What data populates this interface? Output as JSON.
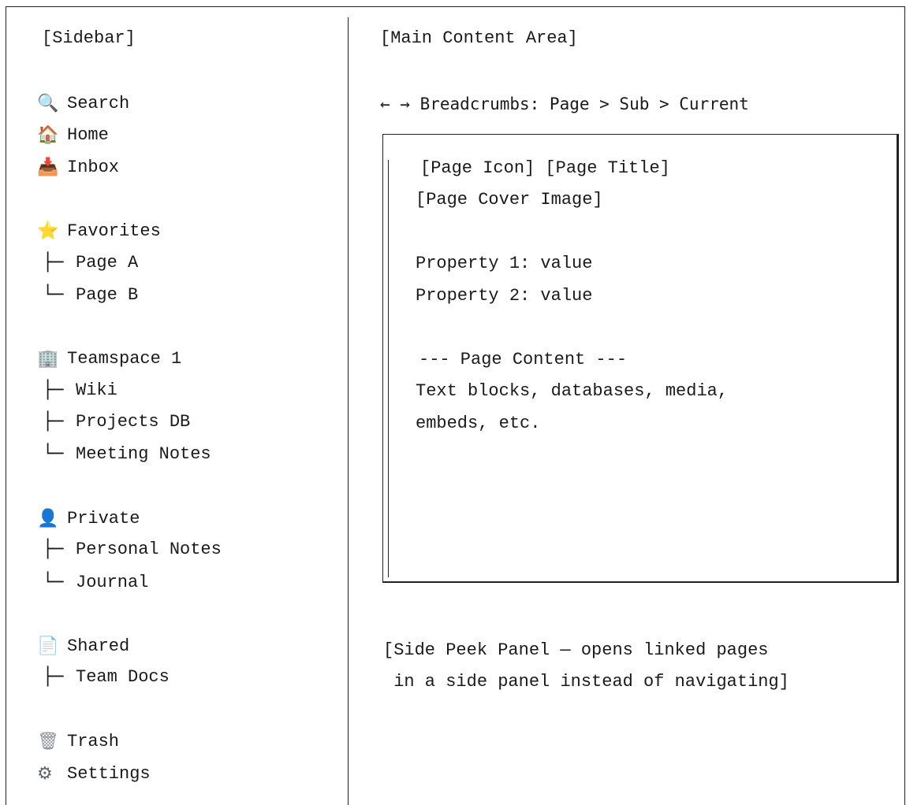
{
  "sidebar": {
    "label": "[Sidebar]",
    "top_items": [
      {
        "icon": "search-icon",
        "glyph": "🔍",
        "label": "Search"
      },
      {
        "icon": "home-icon",
        "glyph": "🏠",
        "label": "Home"
      },
      {
        "icon": "inbox-icon",
        "glyph": "📥",
        "label": "Inbox"
      }
    ],
    "sections": [
      {
        "icon": "star-icon",
        "glyph": "⭐",
        "label": "Favorites",
        "children": [
          {
            "branch": "├─",
            "label": "Page A"
          },
          {
            "branch": "└─",
            "label": "Page B"
          }
        ]
      },
      {
        "icon": "building-icon",
        "glyph": "🏢",
        "label": "Teamspace 1",
        "children": [
          {
            "branch": "├─",
            "label": "Wiki"
          },
          {
            "branch": "├─",
            "label": "Projects DB"
          },
          {
            "branch": "└─",
            "label": "Meeting Notes"
          }
        ]
      },
      {
        "icon": "user-icon",
        "glyph": "👤",
        "label": "Private",
        "children": [
          {
            "branch": "├─",
            "label": "Personal Notes"
          },
          {
            "branch": "└─",
            "label": "Journal"
          }
        ]
      },
      {
        "icon": "document-icon",
        "glyph": "📄",
        "label": "Shared",
        "children": [
          {
            "branch": "├─",
            "label": "Team Docs"
          }
        ]
      }
    ],
    "bottom_items": [
      {
        "icon": "trash-icon",
        "glyph": "🗑",
        "label": "Trash"
      },
      {
        "icon": "gear-icon",
        "glyph": "⚙",
        "label": "Settings"
      }
    ]
  },
  "main": {
    "label": "[Main Content Area]",
    "breadcrumbs": "← → Breadcrumbs: Page > Sub > Current",
    "page": {
      "header": "[Page Icon] [Page Title]",
      "cover": "[Page Cover Image]",
      "properties": [
        "Property 1: value",
        "Property 2: value"
      ],
      "content_heading": "--- Page Content ---",
      "content_lines": [
        "Text blocks, databases, media,",
        "embeds, etc."
      ]
    },
    "side_peek": "[Side Peek Panel — opens linked pages\n in a side panel instead of navigating]"
  }
}
